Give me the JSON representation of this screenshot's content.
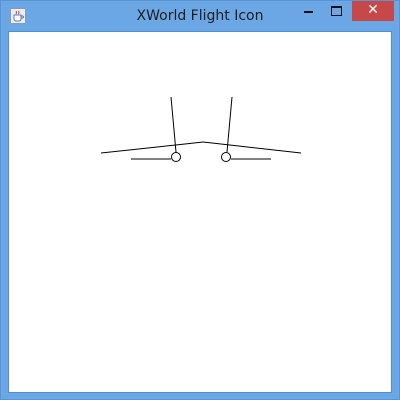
{
  "window": {
    "title": "XWorld Flight Icon",
    "accent_color": "#6ba6e5",
    "close_button_color": "#c74848"
  },
  "titlebar": {
    "app_icon": "java-coffee-cup-icon",
    "minimize_icon": "minimize-icon",
    "maximize_icon": "maximize-icon",
    "close_icon": "close-icon",
    "close_glyph": "✕"
  },
  "canvas": {
    "background": "#ffffff",
    "figure": "flight-icon"
  }
}
